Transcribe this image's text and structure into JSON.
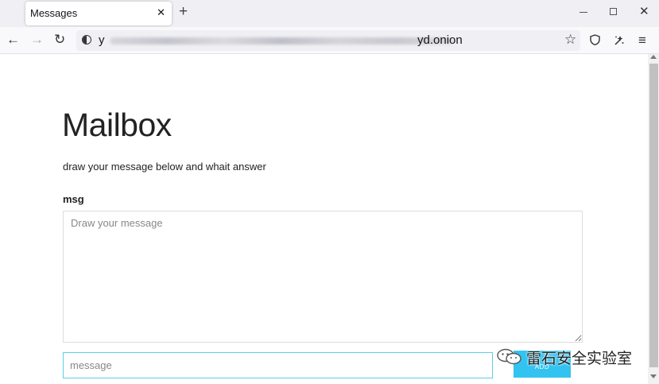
{
  "browser": {
    "tab": {
      "title": "Messages",
      "close_glyph": "✕"
    },
    "new_tab_glyph": "+",
    "window": {
      "close_glyph": "✕"
    },
    "nav": {
      "back_glyph": "←",
      "forward_glyph": "→",
      "reload_glyph": "↻"
    },
    "url": {
      "visible_start": "y",
      "visible_end": "yd.onion",
      "middle_blurred": true
    },
    "icons": [
      "onion-icon",
      "star-icon",
      "shield-icon",
      "extensions-icon",
      "menu-icon"
    ],
    "menu_glyph": "≡",
    "star_glyph": "☆"
  },
  "page": {
    "title": "Mailbox",
    "description": "draw your message below and whait answer",
    "field_label": "msg",
    "textarea_placeholder": "Draw your message",
    "input_placeholder": "message",
    "add_button_label": "ADD"
  },
  "watermark": {
    "text": "雷石安全实验室",
    "logo": "wechat-logo"
  },
  "colors": {
    "accent": "#33c3f0",
    "input_focus_border": "#5bd0e8",
    "tabstrip": "#f0f0f4"
  }
}
